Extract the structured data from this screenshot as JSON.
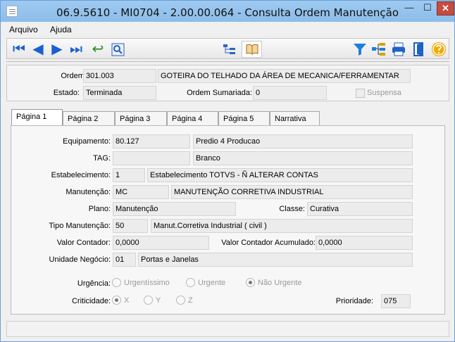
{
  "window": {
    "title": "06.9.5610 - MI0704 - 2.00.00.064 - Consulta Ordem Manutenção"
  },
  "menu": {
    "items": [
      "Arquivo",
      "Ajuda"
    ]
  },
  "toolbar": {
    "left": [
      "first-icon",
      "previous-icon",
      "next-icon",
      "last-icon",
      "return-icon",
      "search-icon"
    ],
    "center": [
      "tree-icon",
      "book-icon"
    ],
    "right": [
      "filter-icon",
      "hierarchy-icon",
      "print-icon",
      "exit-icon",
      "help-icon"
    ]
  },
  "header": {
    "ordem_label": "Ordem:",
    "ordem_value": "301.003",
    "ordem_description": "GOTEIRA DO TELHADO DA ÁREA DE MECANICA/FERRAMENTAR",
    "estado_label": "Estado:",
    "estado_value": "Terminada",
    "ordem_sumariada_label": "Ordem Sumariada:",
    "ordem_sumariada_value": "0",
    "suspensa_label": "Suspensa"
  },
  "tabs": [
    "Página 1",
    "Página 2",
    "Página 3",
    "Página 4",
    "Página 5",
    "Narrativa"
  ],
  "form": {
    "equipamento_label": "Equipamento:",
    "equipamento_code": "80.127",
    "equipamento_desc": "Predio 4 Producao",
    "tag_label": "TAG:",
    "tag_value": "",
    "tag_desc": "Branco",
    "estabelecimento_label": "Estabelecimento:",
    "estabelecimento_code": "1",
    "estabelecimento_desc": "Estabelecimento TOTVS - Ñ ALTERAR CONTAS",
    "manutencao_label": "Manutenção:",
    "manutencao_code": "MC",
    "manutencao_desc": "MANUTENÇÃO CORRETIVA INDUSTRIAL",
    "plano_label": "Plano:",
    "plano_value": "Manutenção",
    "classe_label": "Classe:",
    "classe_value": "Curativa",
    "tipo_label": "Tipo Manutenção:",
    "tipo_code": "50",
    "tipo_desc": "Manut.Corretiva Industrial ( civil )",
    "valor_contador_label": "Valor Contador:",
    "valor_contador_value": "0,0000",
    "valor_acumulado_label": "Valor Contador Acumulado:",
    "valor_acumulado_value": "0,0000",
    "unidade_label": "Unidade Negócio:",
    "unidade_code": "01",
    "unidade_desc": "Portas e Janelas",
    "urgencia_label": "Urgência:",
    "urgencia_options": [
      "Urgentíssimo",
      "Urgente",
      "Não Urgente"
    ],
    "urgencia_selected": "Não Urgente",
    "criticidade_label": "Criticidade:",
    "criticidade_options": [
      "X",
      "Y",
      "Z"
    ],
    "criticidade_selected": "X",
    "prioridade_label": "Prioridade:",
    "prioridade_value": "075"
  }
}
